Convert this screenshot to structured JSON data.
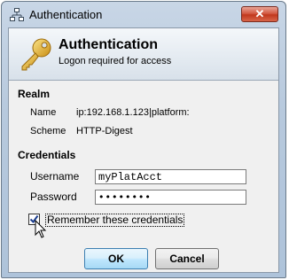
{
  "window": {
    "title": "Authentication",
    "close_label": "✕"
  },
  "banner": {
    "title": "Authentication",
    "subtitle": "Logon required for access"
  },
  "realm": {
    "heading": "Realm",
    "name_label": "Name",
    "name_value": "ip:192.168.1.123|platform:",
    "scheme_label": "Scheme",
    "scheme_value": "HTTP-Digest"
  },
  "credentials": {
    "heading": "Credentials",
    "username_label": "Username",
    "username_value": "myPlatAcct",
    "password_label": "Password",
    "password_value": "••••••••",
    "remember_label": "Remember these credentials",
    "remember_checked": true
  },
  "buttons": {
    "ok_label": "OK",
    "cancel_label": "Cancel"
  },
  "colors": {
    "title_bar": "#b7c9dd",
    "close_button": "#c1381d",
    "ok_border": "#3c7fb1"
  }
}
